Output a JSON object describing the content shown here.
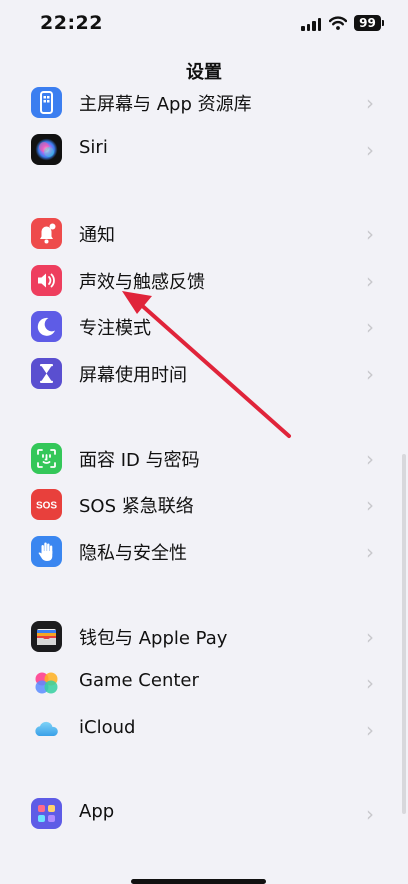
{
  "status": {
    "time": "22:22",
    "battery": "99"
  },
  "nav": {
    "title": "设置"
  },
  "items": [
    {
      "label": "主屏幕与 App 资源库",
      "icon": "home-screen-icon"
    },
    {
      "label": "Siri",
      "icon": "siri-icon"
    },
    {
      "label": "通知",
      "icon": "bell-icon"
    },
    {
      "label": "声效与触感反馈",
      "icon": "speaker-icon"
    },
    {
      "label": "专注模式",
      "icon": "moon-icon"
    },
    {
      "label": "屏幕使用时间",
      "icon": "hourglass-icon"
    },
    {
      "label": "面容 ID 与密码",
      "icon": "face-id-icon"
    },
    {
      "label": "SOS 紧急联络",
      "icon": "sos-icon",
      "icon_text": "SOS"
    },
    {
      "label": "隐私与安全性",
      "icon": "hand-icon"
    },
    {
      "label": "钱包与 Apple Pay",
      "icon": "wallet-icon"
    },
    {
      "label": "Game Center",
      "icon": "game-center-icon"
    },
    {
      "label": "iCloud",
      "icon": "cloud-icon"
    },
    {
      "label": "App",
      "icon": "apps-grid-icon"
    }
  ],
  "chevron": "›",
  "colors": {
    "background": "#f2f2f7",
    "home_screen": "#3b7ef0",
    "notifications": "#ee4b4b",
    "sounds": "#ee3e5e",
    "focus": "#5e5ce6",
    "screen_time": "#5a4fd0",
    "face_id": "#34c759",
    "sos": "#e8403c",
    "privacy": "#3a86f0",
    "arrow": "#e0243a"
  }
}
